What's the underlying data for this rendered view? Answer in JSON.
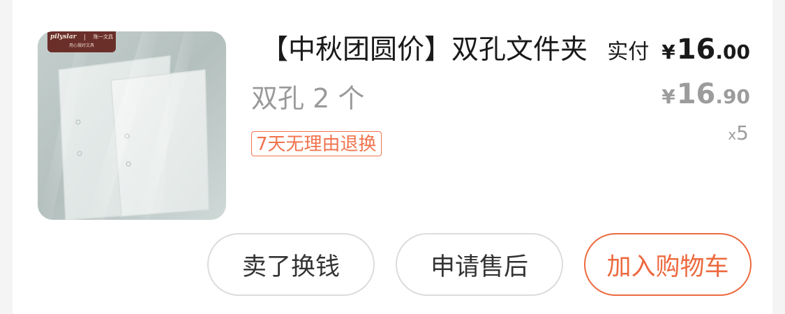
{
  "product": {
    "title": "【中秋团圆价】双孔文件夹",
    "spec": "双孔 2 个",
    "return_tag": "7天无理由退换",
    "brand_logo": {
      "brand": "pilyslar",
      "cn_name": "陈一文具",
      "slogan": "用心做好文具"
    }
  },
  "price": {
    "paid_label": "实付",
    "paid_currency": "¥",
    "paid_int": "16",
    "paid_dec": ".00",
    "orig_currency": "¥",
    "orig_int": "16",
    "orig_dec": ".90"
  },
  "quantity": {
    "prefix": "x",
    "count": "5"
  },
  "actions": {
    "sell": "卖了换钱",
    "after_sales": "申请售后",
    "add_cart": "加入购物车"
  },
  "colors": {
    "accent": "#ec6a3f",
    "tag": "#f0734d",
    "muted": "#9c9c9c"
  }
}
